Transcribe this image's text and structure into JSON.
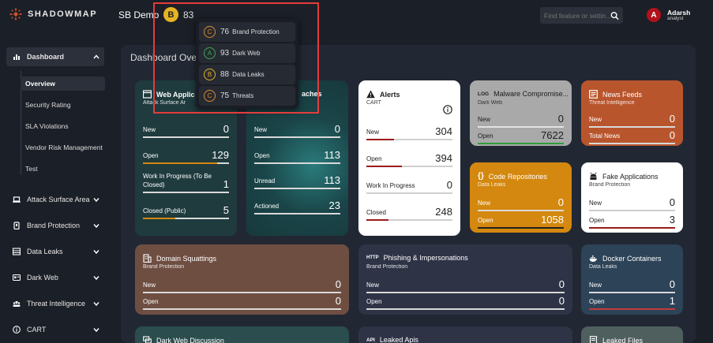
{
  "app": {
    "name": "SHADOWMAP"
  },
  "header": {
    "org": "SB Demo",
    "grade": "B",
    "score": "83",
    "search_placeholder": "Find feature or settin...",
    "user": {
      "initial": "A",
      "name": "Adarsh",
      "role": "analyst"
    }
  },
  "score_popup": [
    {
      "grade": "C",
      "score": "76",
      "label": "Brand Protection",
      "color": "#e08a2a"
    },
    {
      "grade": "A",
      "score": "93",
      "label": "Dark Web",
      "color": "#3fa84a"
    },
    {
      "grade": "B",
      "score": "88",
      "label": "Data Leaks",
      "color": "#e6b422"
    },
    {
      "grade": "C",
      "score": "75",
      "label": "Threats",
      "color": "#e08a2a"
    }
  ],
  "sidebar": {
    "dashboard": "Dashboard",
    "subitems": [
      "Overview",
      "Security Rating",
      "SLA Violations",
      "Vendor Risk Management",
      "Test"
    ],
    "items": [
      "Attack Surface Area",
      "Brand Protection",
      "Data Leaks",
      "Dark Web",
      "Threat Intelligence",
      "CART"
    ]
  },
  "main": {
    "title": "Dashboard Overview"
  },
  "cards": {
    "webapps": {
      "title": "Web Applic",
      "sub": "Attack Surface Ar",
      "rows": [
        {
          "label": "New",
          "value": "0"
        },
        {
          "label": "Open",
          "value": "129"
        },
        {
          "label": "Work In Progress (To Be Closed)",
          "value": "1"
        },
        {
          "label": "Closed (Public)",
          "value": "5"
        }
      ]
    },
    "breaches": {
      "title": "aches",
      "rows": [
        {
          "label": "New",
          "value": "0"
        },
        {
          "label": "Open",
          "value": "113"
        },
        {
          "label": "Unread",
          "value": "113"
        },
        {
          "label": "Actioned",
          "value": "23"
        }
      ]
    },
    "alerts": {
      "title": "Alerts",
      "sub": "CART",
      "rows": [
        {
          "label": "New",
          "value": "304"
        },
        {
          "label": "Open",
          "value": "394"
        },
        {
          "label": "Work In Progress",
          "value": "0"
        },
        {
          "label": "Closed",
          "value": "248"
        }
      ]
    },
    "malware": {
      "title": "Malware Compromise...",
      "sub": "Dark Web",
      "rows": [
        {
          "label": "New",
          "value": "0"
        },
        {
          "label": "Open",
          "value": "7622"
        }
      ]
    },
    "news": {
      "title": "News Feeds",
      "sub": "Threat Intelligence",
      "rows": [
        {
          "label": "New",
          "value": "0"
        },
        {
          "label": "Total News",
          "value": "0"
        }
      ]
    },
    "code": {
      "title": "Code Repositories",
      "sub": "Data Leaks",
      "rows": [
        {
          "label": "New",
          "value": "0"
        },
        {
          "label": "Open",
          "value": "1058"
        }
      ]
    },
    "fake": {
      "title": "Fake Applications",
      "sub": "Brand Protection",
      "rows": [
        {
          "label": "New",
          "value": "0"
        },
        {
          "label": "Open",
          "value": "3"
        }
      ]
    },
    "domain": {
      "title": "Domain Squattings",
      "sub": "Brand Protection",
      "rows": [
        {
          "label": "New",
          "value": "0"
        },
        {
          "label": "Open",
          "value": "0"
        }
      ]
    },
    "phishing": {
      "title": "Phishing & Impersonations",
      "sub": "Brand Protection",
      "rows": [
        {
          "label": "New",
          "value": "0"
        },
        {
          "label": "Open",
          "value": "0"
        }
      ]
    },
    "docker": {
      "title": "Docker Containers",
      "sub": "Data Leaks",
      "rows": [
        {
          "label": "New",
          "value": "0"
        },
        {
          "label": "Open",
          "value": "1"
        }
      ]
    },
    "darkweb_discussion": {
      "title": "Dark Web Discussion"
    },
    "leaked_apis": {
      "title": "Leaked Apis"
    },
    "leaked_files": {
      "title": "Leaked Files"
    }
  }
}
